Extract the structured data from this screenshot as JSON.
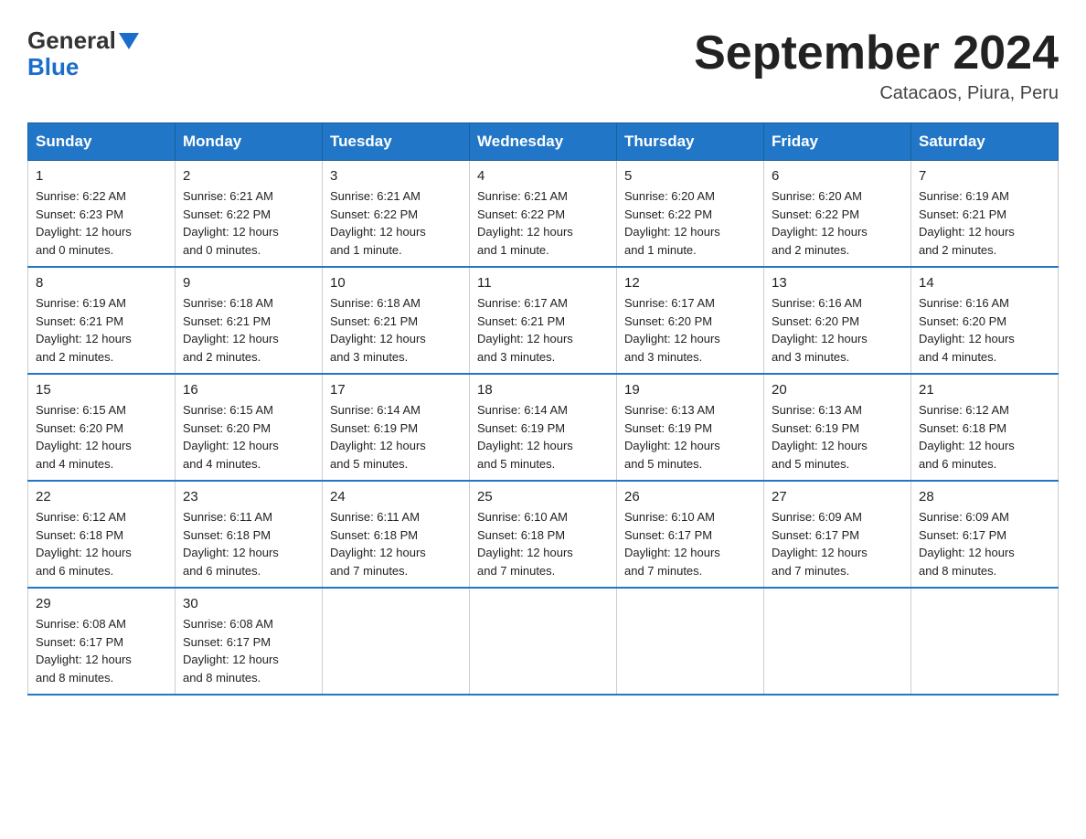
{
  "logo": {
    "general": "General",
    "blue": "Blue"
  },
  "title": "September 2024",
  "subtitle": "Catacaos, Piura, Peru",
  "days_of_week": [
    "Sunday",
    "Monday",
    "Tuesday",
    "Wednesday",
    "Thursday",
    "Friday",
    "Saturday"
  ],
  "weeks": [
    [
      {
        "day": "1",
        "sunrise": "6:22 AM",
        "sunset": "6:23 PM",
        "daylight": "12 hours and 0 minutes."
      },
      {
        "day": "2",
        "sunrise": "6:21 AM",
        "sunset": "6:22 PM",
        "daylight": "12 hours and 0 minutes."
      },
      {
        "day": "3",
        "sunrise": "6:21 AM",
        "sunset": "6:22 PM",
        "daylight": "12 hours and 1 minute."
      },
      {
        "day": "4",
        "sunrise": "6:21 AM",
        "sunset": "6:22 PM",
        "daylight": "12 hours and 1 minute."
      },
      {
        "day": "5",
        "sunrise": "6:20 AM",
        "sunset": "6:22 PM",
        "daylight": "12 hours and 1 minute."
      },
      {
        "day": "6",
        "sunrise": "6:20 AM",
        "sunset": "6:22 PM",
        "daylight": "12 hours and 2 minutes."
      },
      {
        "day": "7",
        "sunrise": "6:19 AM",
        "sunset": "6:21 PM",
        "daylight": "12 hours and 2 minutes."
      }
    ],
    [
      {
        "day": "8",
        "sunrise": "6:19 AM",
        "sunset": "6:21 PM",
        "daylight": "12 hours and 2 minutes."
      },
      {
        "day": "9",
        "sunrise": "6:18 AM",
        "sunset": "6:21 PM",
        "daylight": "12 hours and 2 minutes."
      },
      {
        "day": "10",
        "sunrise": "6:18 AM",
        "sunset": "6:21 PM",
        "daylight": "12 hours and 3 minutes."
      },
      {
        "day": "11",
        "sunrise": "6:17 AM",
        "sunset": "6:21 PM",
        "daylight": "12 hours and 3 minutes."
      },
      {
        "day": "12",
        "sunrise": "6:17 AM",
        "sunset": "6:20 PM",
        "daylight": "12 hours and 3 minutes."
      },
      {
        "day": "13",
        "sunrise": "6:16 AM",
        "sunset": "6:20 PM",
        "daylight": "12 hours and 3 minutes."
      },
      {
        "day": "14",
        "sunrise": "6:16 AM",
        "sunset": "6:20 PM",
        "daylight": "12 hours and 4 minutes."
      }
    ],
    [
      {
        "day": "15",
        "sunrise": "6:15 AM",
        "sunset": "6:20 PM",
        "daylight": "12 hours and 4 minutes."
      },
      {
        "day": "16",
        "sunrise": "6:15 AM",
        "sunset": "6:20 PM",
        "daylight": "12 hours and 4 minutes."
      },
      {
        "day": "17",
        "sunrise": "6:14 AM",
        "sunset": "6:19 PM",
        "daylight": "12 hours and 5 minutes."
      },
      {
        "day": "18",
        "sunrise": "6:14 AM",
        "sunset": "6:19 PM",
        "daylight": "12 hours and 5 minutes."
      },
      {
        "day": "19",
        "sunrise": "6:13 AM",
        "sunset": "6:19 PM",
        "daylight": "12 hours and 5 minutes."
      },
      {
        "day": "20",
        "sunrise": "6:13 AM",
        "sunset": "6:19 PM",
        "daylight": "12 hours and 5 minutes."
      },
      {
        "day": "21",
        "sunrise": "6:12 AM",
        "sunset": "6:18 PM",
        "daylight": "12 hours and 6 minutes."
      }
    ],
    [
      {
        "day": "22",
        "sunrise": "6:12 AM",
        "sunset": "6:18 PM",
        "daylight": "12 hours and 6 minutes."
      },
      {
        "day": "23",
        "sunrise": "6:11 AM",
        "sunset": "6:18 PM",
        "daylight": "12 hours and 6 minutes."
      },
      {
        "day": "24",
        "sunrise": "6:11 AM",
        "sunset": "6:18 PM",
        "daylight": "12 hours and 7 minutes."
      },
      {
        "day": "25",
        "sunrise": "6:10 AM",
        "sunset": "6:18 PM",
        "daylight": "12 hours and 7 minutes."
      },
      {
        "day": "26",
        "sunrise": "6:10 AM",
        "sunset": "6:17 PM",
        "daylight": "12 hours and 7 minutes."
      },
      {
        "day": "27",
        "sunrise": "6:09 AM",
        "sunset": "6:17 PM",
        "daylight": "12 hours and 7 minutes."
      },
      {
        "day": "28",
        "sunrise": "6:09 AM",
        "sunset": "6:17 PM",
        "daylight": "12 hours and 8 minutes."
      }
    ],
    [
      {
        "day": "29",
        "sunrise": "6:08 AM",
        "sunset": "6:17 PM",
        "daylight": "12 hours and 8 minutes."
      },
      {
        "day": "30",
        "sunrise": "6:08 AM",
        "sunset": "6:17 PM",
        "daylight": "12 hours and 8 minutes."
      },
      null,
      null,
      null,
      null,
      null
    ]
  ]
}
